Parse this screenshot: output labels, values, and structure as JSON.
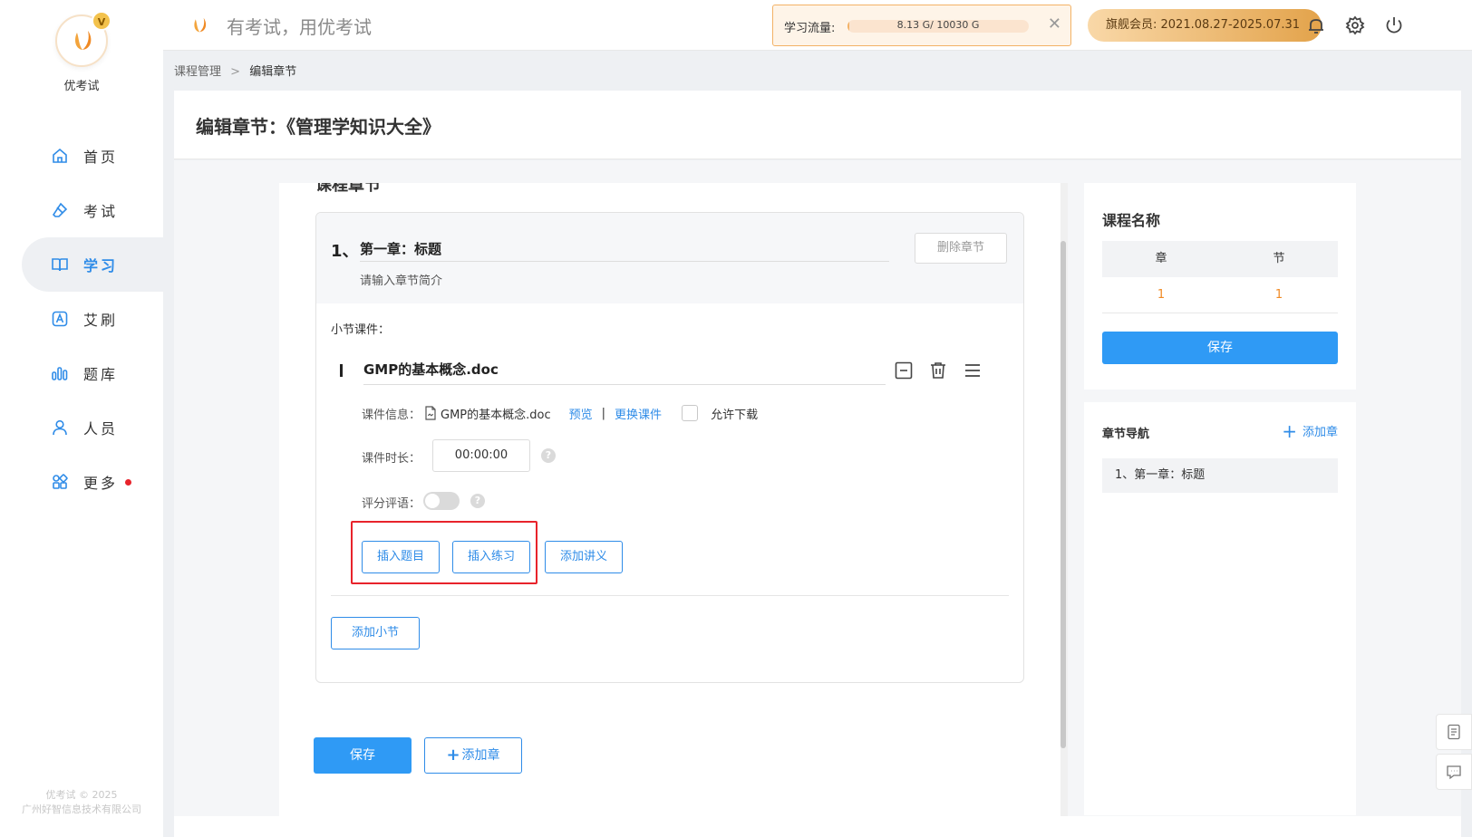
{
  "brand": {
    "name": "优考试",
    "crown_letter": "V",
    "footer_line1": "优考试 © 2025",
    "footer_line2": "广州好智信息技术有限公司"
  },
  "sidebar": {
    "items": [
      {
        "label": "首页",
        "icon": "home-icon"
      },
      {
        "label": "考试",
        "icon": "eraser-icon"
      },
      {
        "label": "学习",
        "icon": "book-icon",
        "active": true
      },
      {
        "label": "艾刷",
        "icon": "a-badge-icon"
      },
      {
        "label": "题库",
        "icon": "bar-chart-icon"
      },
      {
        "label": "人员",
        "icon": "person-icon"
      },
      {
        "label": "更多",
        "icon": "apps-icon",
        "badge_dot": true
      }
    ]
  },
  "header": {
    "slogan": "有考试，用优考试",
    "traffic": {
      "label": "学习流量:",
      "value_text": "8.13 G/ 10030 G",
      "used_fraction": 0.0008
    },
    "membership": "旗舰会员: 2021.08.27-2025.07.31",
    "icons": [
      "bell-icon",
      "gear-icon",
      "power-icon"
    ]
  },
  "breadcrumb": {
    "parent": "课程管理",
    "separator": ">",
    "current": "编辑章节"
  },
  "page_title": "编辑章节：《管理学知识大全》",
  "chapter": {
    "partial_heading": "课程章节",
    "number": "1、",
    "title": "第一章：标题",
    "description_placeholder": "请输入章节简介",
    "delete_label": "删除章节",
    "section_label": "小节课件：",
    "courseware": {
      "name": "GMP的基本概念.doc",
      "info_label": "课件信息：",
      "file_name": "GMP的基本概念.doc",
      "preview": "预览",
      "separator": "|",
      "replace": "更换课件",
      "allow_download": "允许下载",
      "duration_label": "课件时长：",
      "duration_value": "00:00:00",
      "score_label": "评分评语：",
      "help_glyph": "?"
    },
    "actions": {
      "insert_question": "插入题目",
      "insert_exercise": "插入练习",
      "add_handout": "添加讲义"
    },
    "add_section": "添加小节"
  },
  "footer_buttons": {
    "save": "保存",
    "add_chapter": "添加章"
  },
  "right_panel": {
    "course_name_title": "课程名称",
    "table_headers": [
      "章",
      "节"
    ],
    "table_values": [
      "1",
      "1"
    ],
    "save": "保存",
    "nav_title": "章节导航",
    "add_chapter": "添加章",
    "nav_items": [
      "1、第一章：标题"
    ]
  },
  "colors": {
    "accent": "#2f8ce8",
    "primary_button": "#2f9af5",
    "highlight_box": "#e8232b",
    "count_text": "#f08a24"
  }
}
